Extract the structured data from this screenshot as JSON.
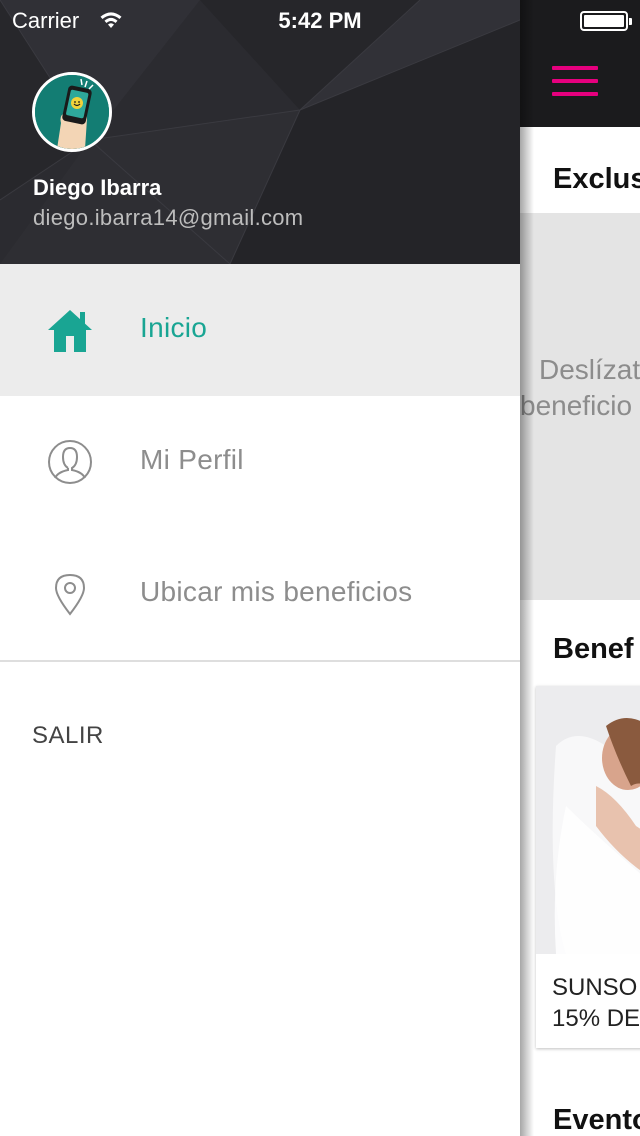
{
  "status_bar": {
    "carrier": "Carrier",
    "time": "5:42 PM"
  },
  "user": {
    "name": "Diego Ibarra",
    "email": "diego.ibarra14@gmail.com"
  },
  "menu": {
    "items": [
      {
        "label": "Inicio",
        "icon": "home-icon",
        "active": true
      },
      {
        "label": "Mi Perfil",
        "icon": "user-profile-icon",
        "active": false
      },
      {
        "label": "Ubicar mis beneficios",
        "icon": "location-pin-icon",
        "active": false
      }
    ],
    "logout_label": "SALIR"
  },
  "main": {
    "section1_title": "Exclus",
    "slide_text_line1": "Deslízat",
    "slide_text_line2": "beneficio",
    "section2_title": "Benef",
    "card_line1": "SUNSO",
    "card_line2": "15% DE",
    "section3_title": "Evento"
  },
  "colors": {
    "accent_teal": "#19a593",
    "accent_magenta": "#e6007e",
    "header_dark": "#2a2a2f",
    "topbar_dark": "#1b1b1d"
  }
}
